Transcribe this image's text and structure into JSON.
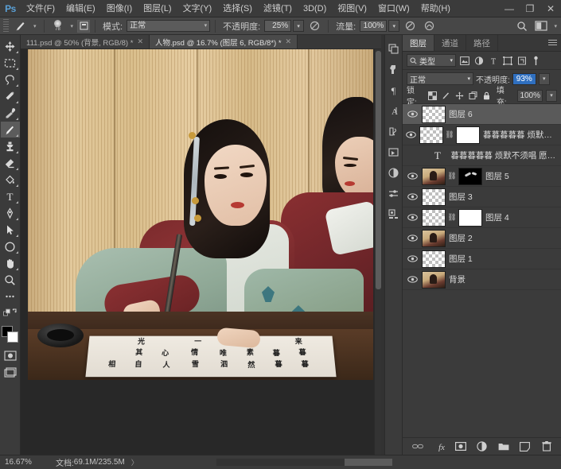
{
  "app": {
    "logo": "Ps",
    "title": "Adobe Photoshop"
  },
  "menubar": {
    "items": [
      {
        "label": "文件(F)"
      },
      {
        "label": "编辑(E)"
      },
      {
        "label": "图像(I)"
      },
      {
        "label": "图层(L)"
      },
      {
        "label": "文字(Y)"
      },
      {
        "label": "选择(S)"
      },
      {
        "label": "滤镜(T)"
      },
      {
        "label": "3D(D)"
      },
      {
        "label": "视图(V)"
      },
      {
        "label": "窗口(W)"
      },
      {
        "label": "帮助(H)"
      }
    ],
    "window_controls": {
      "minimize": "—",
      "maximize": "❐",
      "close": "✕"
    }
  },
  "options_bar": {
    "tool_icon": "brush-icon",
    "brush_size": "78",
    "mode_label": "模式:",
    "mode_value": "正常",
    "opacity_label": "不透明度:",
    "opacity_value": "25%",
    "flow_label": "流量:",
    "flow_value": "100%",
    "airbrush_icon": "airbrush-icon",
    "smoothing_icon": "smoothing-icon",
    "pressure_icon": "pressure-icon",
    "search_icon": "search-icon",
    "workspace_icon": "workspace-icon"
  },
  "toolbar": {
    "tools": [
      {
        "name": "move-tool",
        "icon": "move-icon",
        "active": false
      },
      {
        "name": "marquee-tool",
        "icon": "rectangular-marquee-icon",
        "active": false
      },
      {
        "name": "lasso-tool",
        "icon": "lasso-icon",
        "active": false
      },
      {
        "name": "quick-selection-tool",
        "icon": "magic-wand-icon",
        "active": false
      },
      {
        "name": "eyedropper-tool",
        "icon": "eyedropper-icon",
        "active": false
      },
      {
        "name": "brush-tool",
        "icon": "brush-icon",
        "active": true
      },
      {
        "name": "clone-stamp-tool",
        "icon": "clone-stamp-icon",
        "active": false
      },
      {
        "name": "eraser-tool",
        "icon": "eraser-icon",
        "active": false
      },
      {
        "name": "paint-bucket-tool",
        "icon": "paint-bucket-icon",
        "active": false
      },
      {
        "name": "type-tool",
        "icon": "text-t-icon",
        "active": false
      },
      {
        "name": "pen-tool",
        "icon": "pen-icon",
        "active": false
      },
      {
        "name": "path-selection-tool",
        "icon": "path-arrow-icon",
        "active": false
      },
      {
        "name": "shape-tool",
        "icon": "ellipse-icon",
        "active": false
      },
      {
        "name": "hand-tool",
        "icon": "hand-icon",
        "active": false
      },
      {
        "name": "zoom-tool",
        "icon": "magnifier-icon",
        "active": false
      },
      {
        "name": "more-tools",
        "icon": "ellipsis-icon",
        "active": false
      }
    ],
    "foreground_color": "#000000",
    "background_color": "#ffffff",
    "quickmask_icon": "quick-mask-icon",
    "screenmode_icon": "screen-mode-icon"
  },
  "document_tabs": [
    {
      "label": "111.psd @ 50% (背景, RGB/8) *",
      "active": false,
      "close": "✕"
    },
    {
      "label": "人物.psd @ 16.7% (图层 6, RGB/8*) *",
      "active": true,
      "close": "✕"
    }
  ],
  "canvas": {
    "calligraphy_rows": [
      [
        "光",
        "一",
        "来"
      ],
      [
        "其",
        "心",
        "情",
        "唯",
        "素",
        "暮",
        "暮"
      ],
      [
        "相",
        "自",
        "人",
        "雪",
        "泗",
        "然",
        "暮",
        "暮"
      ]
    ]
  },
  "dock_rail": {
    "icons": [
      {
        "name": "libraries-icon",
        "glyph": "libraries"
      },
      {
        "name": "adjustments-icon",
        "glyph": "adjustments"
      },
      {
        "name": "paragraph-icon",
        "glyph": "paragraph"
      },
      {
        "name": "character-icon",
        "glyph": "character"
      },
      {
        "name": "history-icon",
        "glyph": "history"
      },
      {
        "name": "actions-icon",
        "glyph": "actions"
      },
      {
        "name": "adjustment-layer-icon",
        "glyph": "halfcircle"
      },
      {
        "name": "properties-icon",
        "glyph": "sliders"
      },
      {
        "name": "channels-mixer-icon",
        "glyph": "mixer"
      }
    ]
  },
  "layers_panel": {
    "tabs": [
      {
        "label": "图层",
        "active": true
      },
      {
        "label": "通道",
        "active": false
      },
      {
        "label": "路径",
        "active": false
      }
    ],
    "panel_menu_icon": "panel-menu-icon",
    "filter": {
      "search_icon": "search-icon",
      "kind_label": "类型",
      "caret": "▾",
      "icons": [
        {
          "name": "filter-pixel-icon"
        },
        {
          "name": "filter-adjustment-icon"
        },
        {
          "name": "filter-type-icon"
        },
        {
          "name": "filter-shape-icon"
        },
        {
          "name": "filter-smart-object-icon"
        },
        {
          "name": "filter-toggle-icon"
        }
      ]
    },
    "blend_mode": "正常",
    "opacity_label": "不透明度:",
    "opacity_value": "93%",
    "lock_label": "锁定:",
    "lock_icons": [
      {
        "name": "lock-transparent-pixels-icon"
      },
      {
        "name": "lock-image-pixels-icon"
      },
      {
        "name": "lock-position-icon"
      },
      {
        "name": "lock-artboard-icon"
      },
      {
        "name": "lock-all-icon"
      }
    ],
    "fill_label": "填充:",
    "fill_value": "100%",
    "layers": [
      {
        "name": "图层 6",
        "thumb": "transparent",
        "visible": true,
        "selected": true,
        "has_mask": false,
        "is_text": false,
        "indent": false
      },
      {
        "name": "暮暮暮暮暮 烦默不须唱 愿...",
        "thumb": "transparent",
        "visible": true,
        "selected": false,
        "has_mask": true,
        "mask_thumb": "white",
        "is_text": false,
        "indent": false
      },
      {
        "name": "暮暮暮暮暮 烦默不须唱 愿得一人...",
        "thumb": "text",
        "visible": false,
        "selected": false,
        "has_mask": false,
        "is_text": true,
        "indent": true
      },
      {
        "name": "图层 5",
        "thumb": "photo",
        "visible": true,
        "selected": false,
        "has_mask": true,
        "mask_thumb": "black",
        "is_text": false,
        "indent": false
      },
      {
        "name": "图层 3",
        "thumb": "transparent",
        "visible": true,
        "selected": false,
        "has_mask": false,
        "is_text": false,
        "indent": false
      },
      {
        "name": "图层 4",
        "thumb": "transparent",
        "visible": true,
        "selected": false,
        "has_mask": true,
        "mask_thumb": "white",
        "is_text": false,
        "indent": false
      },
      {
        "name": "图层 2",
        "thumb": "photo",
        "visible": true,
        "selected": false,
        "has_mask": false,
        "is_text": false,
        "indent": false
      },
      {
        "name": "图层 1",
        "thumb": "transparent",
        "visible": true,
        "selected": false,
        "has_mask": false,
        "is_text": false,
        "indent": false
      },
      {
        "name": "背景",
        "thumb": "photo",
        "visible": true,
        "selected": false,
        "has_mask": false,
        "is_text": false,
        "indent": false
      }
    ],
    "footer_buttons": [
      {
        "name": "link-layers-button",
        "icon": "link-icon"
      },
      {
        "name": "layer-style-button",
        "icon": "fx-icon"
      },
      {
        "name": "add-mask-button",
        "icon": "mask-icon"
      },
      {
        "name": "adjustment-layer-button",
        "icon": "half-circle-icon"
      },
      {
        "name": "new-group-button",
        "icon": "folder-icon"
      },
      {
        "name": "new-layer-button",
        "icon": "new-layer-icon"
      },
      {
        "name": "delete-layer-button",
        "icon": "trash-icon"
      }
    ]
  },
  "statusbar": {
    "zoom": "16.67%",
    "doc_label": "文档:",
    "doc_value": "69.1M/235.5M",
    "arrow": "〉"
  }
}
